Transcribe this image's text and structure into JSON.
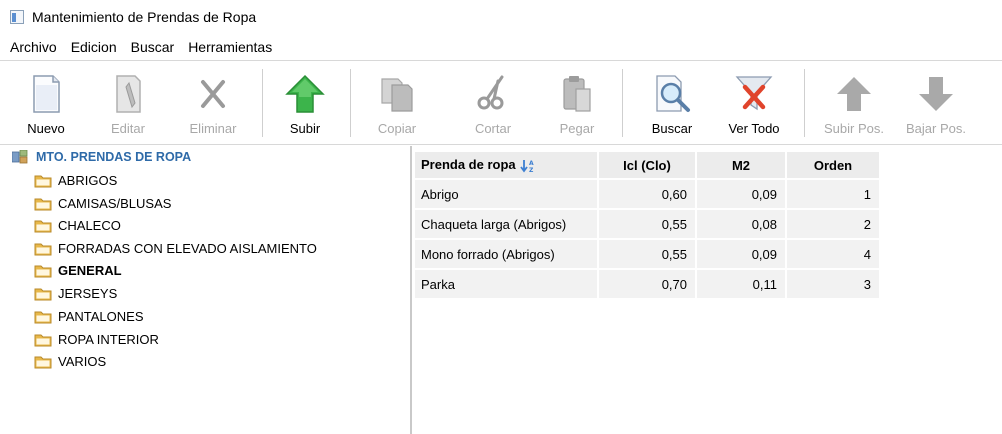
{
  "window": {
    "title": "Mantenimiento de Prendas de Ropa"
  },
  "menu": [
    "Archivo",
    "Edicion",
    "Buscar",
    "Herramientas"
  ],
  "toolbar": {
    "nuevo": "Nuevo",
    "editar": "Editar",
    "eliminar": "Eliminar",
    "subir": "Subir",
    "copiar": "Copiar",
    "cortar": "Cortar",
    "pegar": "Pegar",
    "buscar": "Buscar",
    "ver_todo": "Ver Todo",
    "subir_pos": "Subir Pos.",
    "bajar_pos": "Bajar Pos."
  },
  "tree": {
    "root": "MTO. PRENDAS DE ROPA",
    "items": [
      "ABRIGOS",
      "CAMISAS/BLUSAS",
      "CHALECO",
      "FORRADAS CON ELEVADO AISLAMIENTO",
      "GENERAL",
      "JERSEYS",
      "PANTALONES",
      "ROPA INTERIOR",
      "VARIOS"
    ]
  },
  "table": {
    "headers": [
      "Prenda de ropa",
      "Icl (Clo)",
      "M2",
      "Orden"
    ],
    "rows": [
      [
        "Abrigo",
        "0,60",
        "0,09",
        "1"
      ],
      [
        "Chaqueta larga (Abrigos)",
        "0,55",
        "0,08",
        "2"
      ],
      [
        "Mono forrado (Abrigos)",
        "0,55",
        "0,09",
        "4"
      ],
      [
        "Parka",
        "0,70",
        "0,11",
        "3"
      ]
    ]
  },
  "colors": {
    "tree_root": "#2e6aa8",
    "subir_arrow": "#3cb44b",
    "vertodo_x": "#e0442c",
    "folder": "#e8b84a"
  }
}
